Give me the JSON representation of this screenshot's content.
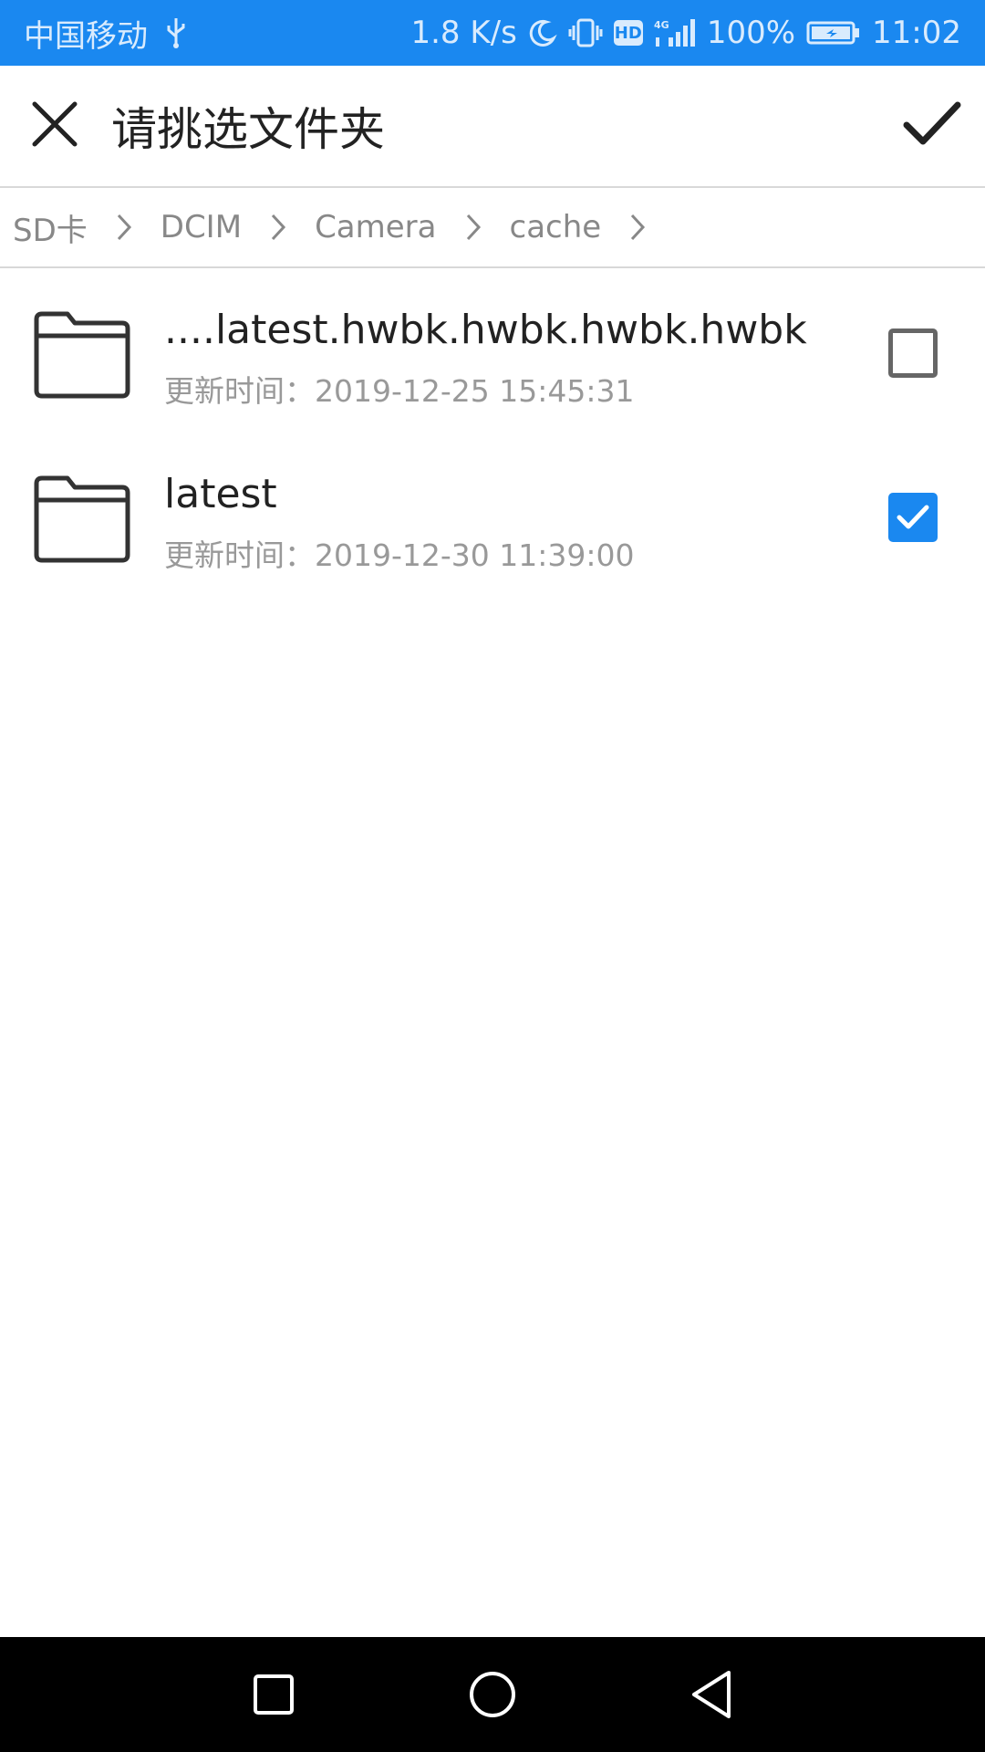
{
  "status_bar": {
    "carrier": "中国移动",
    "network_speed": "1.8 K/s",
    "hd_label": "HD",
    "signal_label": "4G",
    "battery": "100%",
    "time": "11:02",
    "icons": [
      "usb-icon",
      "moon-icon",
      "vibrate-icon",
      "hd-icon",
      "signal-icon",
      "battery-icon"
    ]
  },
  "header": {
    "title": "请挑选文件夹",
    "close_icon": "close-icon",
    "confirm_icon": "check-icon"
  },
  "breadcrumb": {
    "items": [
      "SD卡",
      "DCIM",
      "Camera",
      "cache"
    ]
  },
  "folders": [
    {
      "name": "....latest.hwbk.hwbk.hwbk.hwbk",
      "updated": "更新时间：2019-12-25 15:45:31",
      "checked": false
    },
    {
      "name": "latest",
      "updated": "更新时间：2019-12-30 11:39:00",
      "checked": true
    }
  ],
  "nav_bar": {
    "buttons": [
      "recents-icon",
      "home-icon",
      "back-icon"
    ]
  },
  "colors": {
    "accent": "#1a88f0",
    "text_primary": "#222222",
    "text_secondary": "#999999"
  }
}
